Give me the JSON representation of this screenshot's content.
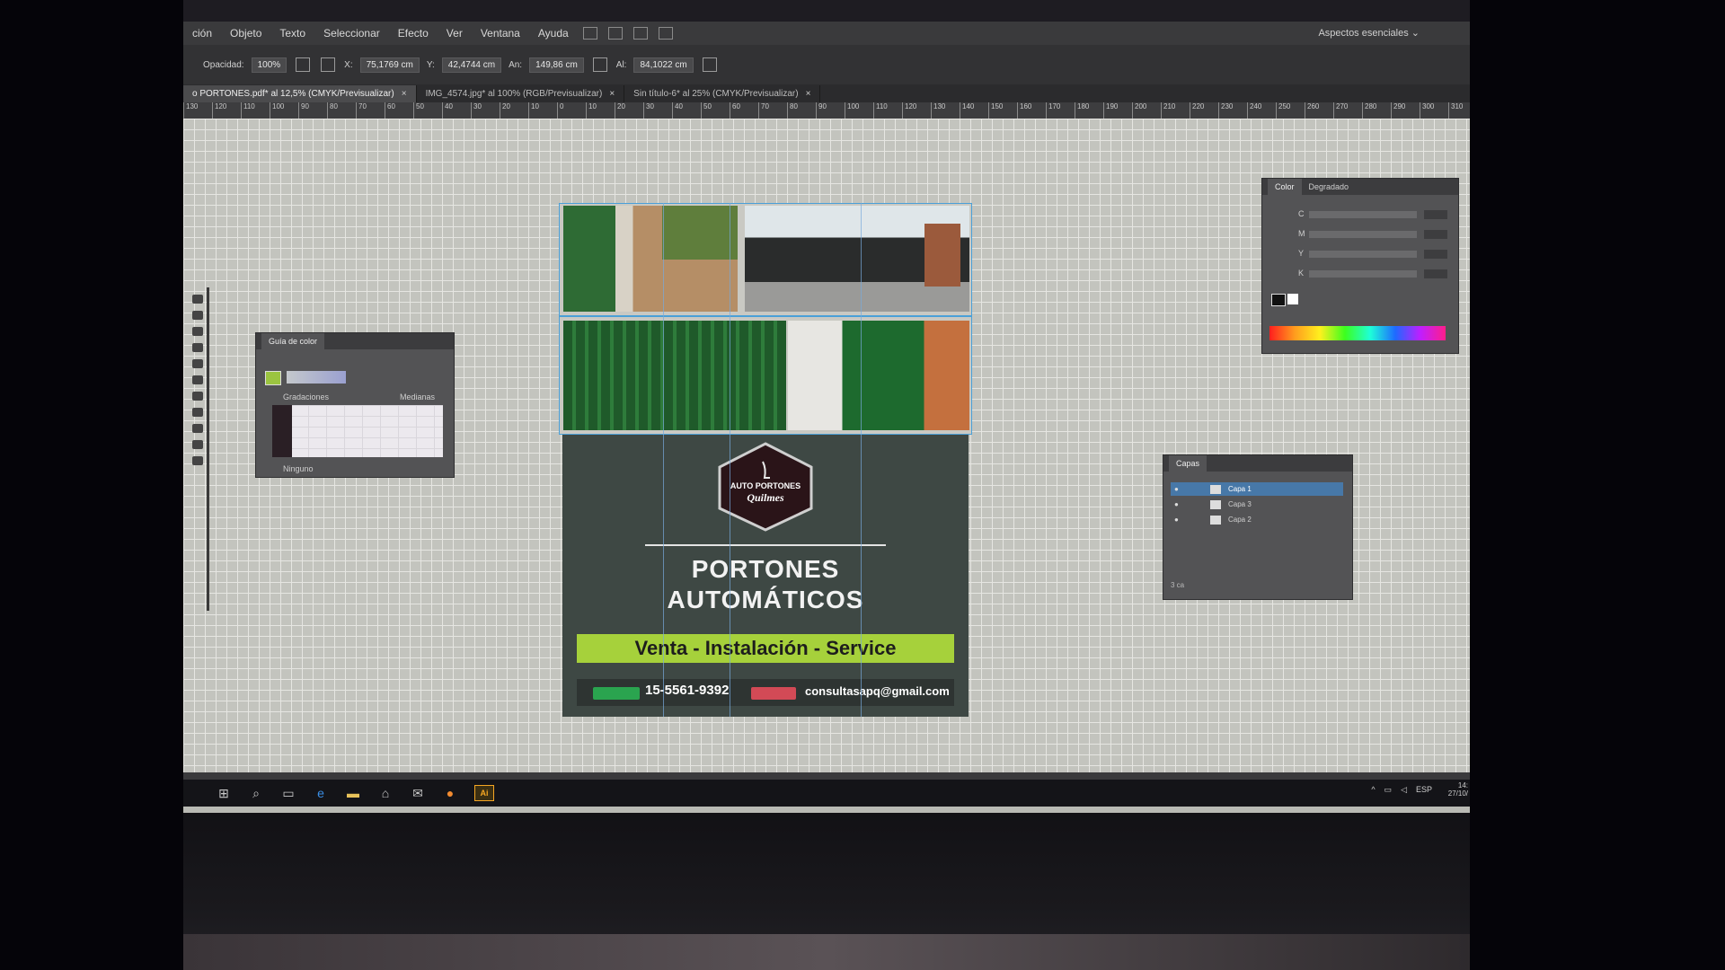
{
  "menu": {
    "items": [
      "ción",
      "Objeto",
      "Texto",
      "Seleccionar",
      "Efecto",
      "Ver",
      "Ventana",
      "Ayuda"
    ],
    "workspace": "Aspectos esenciales ⌄"
  },
  "control_bar": {
    "opacity_label": "Opacidad:",
    "opacity_value": "100%",
    "x_value": "75,1769 cm",
    "y_value": "42,4744 cm",
    "width_label": "An:",
    "width_value": "149,86 cm",
    "height_label": "Al:",
    "height_value": "84,1022 cm"
  },
  "tabs": [
    {
      "label": "o PORTONES.pdf* al 12,5% (CMYK/Previsualizar)",
      "close": "×"
    },
    {
      "label": "IMG_4574.jpg* al 100% (RGB/Previsualizar)",
      "close": "×"
    },
    {
      "label": "Sin título-6* al 25% (CMYK/Previsualizar)",
      "close": "×"
    }
  ],
  "ruler": {
    "ticks": [
      "130",
      "120",
      "110",
      "100",
      "90",
      "80",
      "70",
      "60",
      "50",
      "40",
      "30",
      "20",
      "10",
      "0",
      "10",
      "20",
      "30",
      "40",
      "50",
      "60",
      "70",
      "80",
      "90",
      "100",
      "110",
      "120",
      "130",
      "140",
      "150",
      "160",
      "170",
      "180",
      "190",
      "200",
      "210",
      "220",
      "230",
      "240",
      "250",
      "260",
      "270",
      "280",
      "290",
      "300",
      "310"
    ]
  },
  "flyer": {
    "logo_line1": "AUTO PORTONES",
    "logo_line2": "Quilmes",
    "headline1": "PORTONES",
    "headline2": "AUTOMÁTICOS",
    "tagline": "Venta - Instalación - Service",
    "phone": "15-5561-9392",
    "email": "consultasapq@gmail.com"
  },
  "panels": {
    "color_guide": {
      "title": "Guía de color",
      "sub_left": "Gradaciones",
      "sub_right": "Medianas",
      "footer": "Ninguno"
    },
    "color": {
      "tab_active": "Color",
      "tab_other": "Degradado",
      "channels": [
        "C",
        "M",
        "Y",
        "K"
      ]
    },
    "layers": {
      "title": "Capas",
      "rows": [
        "Capa 1",
        "Capa 3",
        "Capa 2"
      ],
      "footer": "3 ca"
    }
  },
  "taskbar": {
    "lang": "ESP",
    "time": "14:",
    "date": "27/10/"
  },
  "colors": {
    "accent_green": "#a6d13b",
    "flyer_bg": "#3e4844",
    "selection_blue": "#4aa0d8",
    "illustrator_orange": "#f5a623"
  }
}
